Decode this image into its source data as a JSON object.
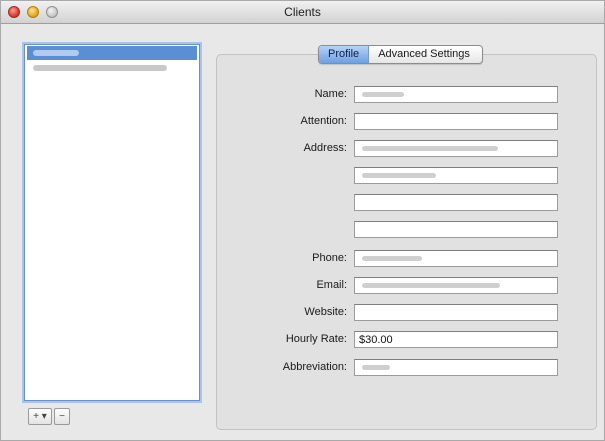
{
  "window": {
    "title": "Clients"
  },
  "client_list": {
    "items": [
      {
        "label": "",
        "selected": true
      },
      {
        "label": "",
        "selected": false
      }
    ],
    "add_label": "+ ▾",
    "remove_label": "−"
  },
  "tabs": [
    {
      "label": "Profile",
      "active": true
    },
    {
      "label": "Advanced Settings",
      "active": false
    }
  ],
  "form": {
    "name_label": "Name:",
    "name_value": "",
    "attention_label": "Attention:",
    "attention_value": "",
    "address_label": "Address:",
    "address_line1": "",
    "address_line2": "",
    "address_line3": "",
    "address_line4": "",
    "phone_label": "Phone:",
    "phone_value": "",
    "email_label": "Email:",
    "email_value": "",
    "website_label": "Website:",
    "website_value": "",
    "hourly_rate_label": "Hourly Rate:",
    "hourly_rate_value": "$30.00",
    "abbreviation_label": "Abbreviation:",
    "abbreviation_value": ""
  },
  "colors": {
    "selection": "#5a8fd6",
    "tab_active": "#6e9fe3",
    "focus_ring": "#a9c3ea"
  }
}
